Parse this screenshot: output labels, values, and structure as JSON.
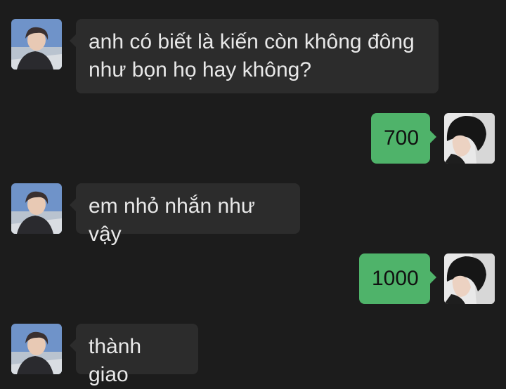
{
  "conversation": {
    "messages": [
      {
        "sender": "them",
        "lines": [
          "anh có biết là kiến còn không đông",
          "như bọn họ hay không?"
        ]
      },
      {
        "sender": "me",
        "text": "700"
      },
      {
        "sender": "them",
        "text": "em nhỏ nhắn như vậy"
      },
      {
        "sender": "me",
        "text": "1000"
      },
      {
        "sender": "them",
        "text": "thành giao"
      }
    ]
  },
  "colors": {
    "background": "#1c1c1c",
    "incoming_bubble": "#2c2c2c",
    "outgoing_bubble": "#4fb36a",
    "incoming_text": "#e8e8e8",
    "outgoing_text": "#111111"
  }
}
